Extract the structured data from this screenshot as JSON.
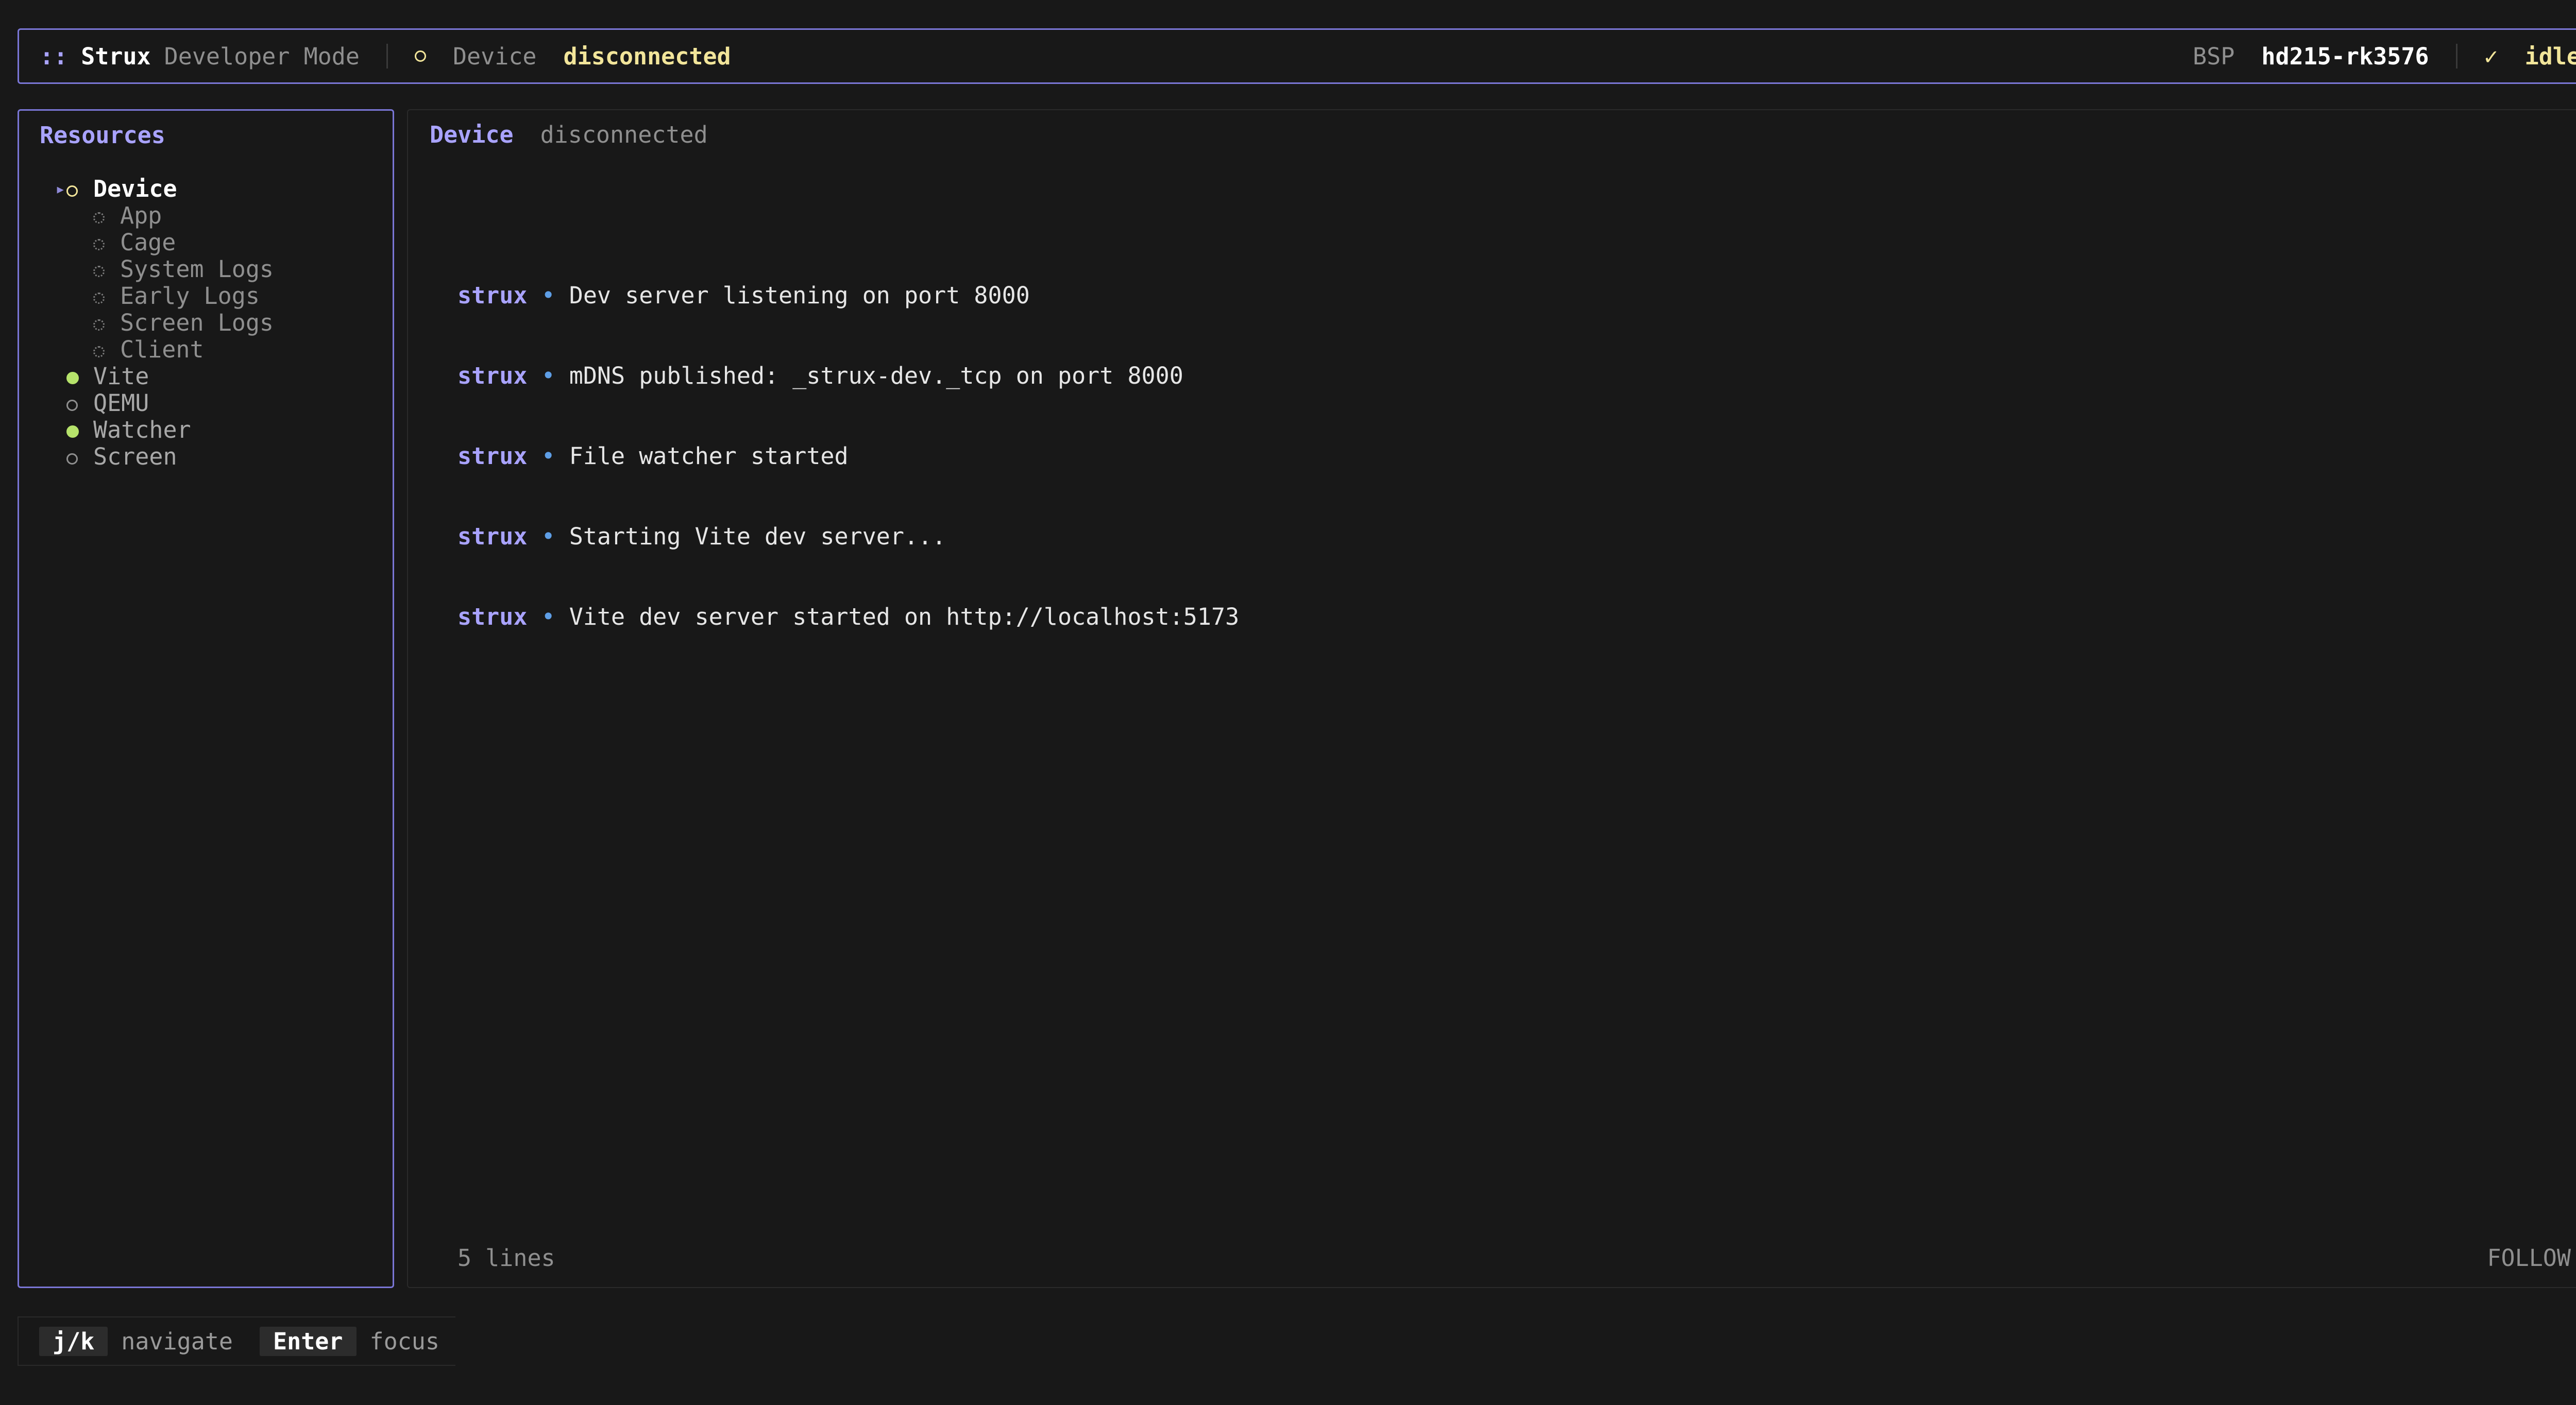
{
  "topbar": {
    "logo_glyph": "::",
    "app_name": "Strux",
    "mode": "Developer Mode",
    "device_label": "Device",
    "device_status": "disconnected",
    "bsp_label": "BSP",
    "bsp_value": "hd215-rk3576",
    "check_glyph": "✓",
    "state": "idle"
  },
  "sidebar": {
    "title": "Resources",
    "items": [
      {
        "label": "Device",
        "level": 0,
        "status": "pending",
        "expanded": true,
        "selected": true
      },
      {
        "label": "App",
        "level": 1,
        "status": "inactive"
      },
      {
        "label": "Cage",
        "level": 1,
        "status": "inactive"
      },
      {
        "label": "System Logs",
        "level": 1,
        "status": "inactive"
      },
      {
        "label": "Early Logs",
        "level": 1,
        "status": "inactive"
      },
      {
        "label": "Screen Logs",
        "level": 1,
        "status": "inactive"
      },
      {
        "label": "Client",
        "level": 1,
        "status": "inactive"
      },
      {
        "label": "Vite",
        "level": 0,
        "status": "running"
      },
      {
        "label": "QEMU",
        "level": 0,
        "status": "stopped"
      },
      {
        "label": "Watcher",
        "level": 0,
        "status": "running"
      },
      {
        "label": "Screen",
        "level": 0,
        "status": "stopped"
      }
    ]
  },
  "main": {
    "title": "Device",
    "status": "disconnected",
    "logs": [
      {
        "source": "strux",
        "bullet": "•",
        "message": "Dev server listening on port 8000"
      },
      {
        "source": "strux",
        "bullet": "•",
        "message": "mDNS published: _strux-dev._tcp on port 8000"
      },
      {
        "source": "strux",
        "bullet": "•",
        "message": "File watcher started"
      },
      {
        "source": "strux",
        "bullet": "•",
        "message": "Starting Vite dev server..."
      },
      {
        "source": "strux",
        "bullet": "•",
        "message": "Vite dev server started on http://localhost:5173"
      }
    ],
    "line_count": "5 lines",
    "follow": "FOLLOW"
  },
  "footer": {
    "hints": [
      {
        "key": "j/k",
        "action": "navigate"
      },
      {
        "key": "Enter",
        "action": "focus"
      }
    ]
  },
  "colors": {
    "accent": "#a9a3ff",
    "border": "#7a76d6",
    "warning": "#f2e59a",
    "success": "#b6e36b",
    "bullet": "#5e9ee6",
    "background": "#181818"
  }
}
